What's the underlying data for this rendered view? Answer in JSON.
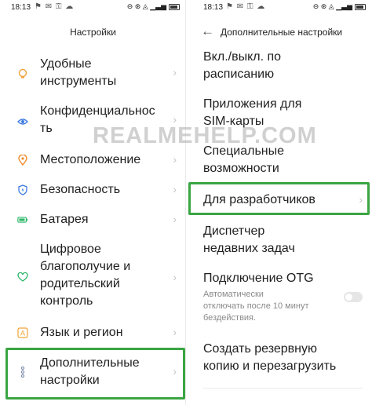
{
  "left": {
    "status": {
      "time": "18:13",
      "notif_icons": "⚑ ✉ ⚿ ☁",
      "sys_icons": "⊖ ⊛ ◬ ▁▃▅"
    },
    "header_title": "Настройки",
    "items": [
      {
        "label": "Удобные\nинструменты",
        "icon": "bulb-icon",
        "icon_color": "#f0a338"
      },
      {
        "label": "Конфиденциальнос\nть",
        "icon": "privacy-eye-icon",
        "icon_color": "#3d7be0"
      },
      {
        "label": "Местоположение",
        "icon": "location-pin-icon",
        "icon_color": "#f08a2c"
      },
      {
        "label": "Безопасность",
        "icon": "shield-bolt-icon",
        "icon_color": "#3d7be0"
      },
      {
        "label": "Батарея",
        "icon": "battery-icon",
        "icon_color": "#2fb86a"
      },
      {
        "label": "Цифровое\nблагополучие и\nродительский\nконтроль",
        "icon": "heart-person-icon",
        "icon_color": "#2fb86a"
      },
      {
        "label": "Язык и регион",
        "icon": "language-a-icon",
        "icon_color": "#f0a338"
      },
      {
        "label": "Дополнительные\nнастройки",
        "icon": "more-dots-icon",
        "icon_color": "#7b8ca8"
      }
    ]
  },
  "right": {
    "status": {
      "time": "18:13",
      "notif_icons": "⚑ ✉ ⚿ ☁",
      "sys_icons": "⊖ ⊛ ◬ ▁▃▅"
    },
    "header_title": "Дополнительные настройки",
    "items": [
      {
        "label": "Вкл./выкл. по\nрасписанию"
      },
      {
        "label": "Приложения для\nSIM-карты"
      },
      {
        "label": "Специальные\nвозможности"
      },
      {
        "label": "Для разработчиков"
      },
      {
        "label": "Диспетчер\nнедавних задач"
      },
      {
        "label": "Подключение OTG",
        "sub": "Автоматически\nотключать после 10 минут\nбездействия.",
        "toggle": false
      },
      {
        "label": "Создать резервную\nкопию и перезагрузить"
      }
    ]
  },
  "watermark": "REALMEHELP.COM",
  "colors": {
    "highlight": "#3aa542",
    "chevron": "#c4c4c4",
    "text": "#1f1f1f",
    "sub_text": "#8a8a8a"
  }
}
